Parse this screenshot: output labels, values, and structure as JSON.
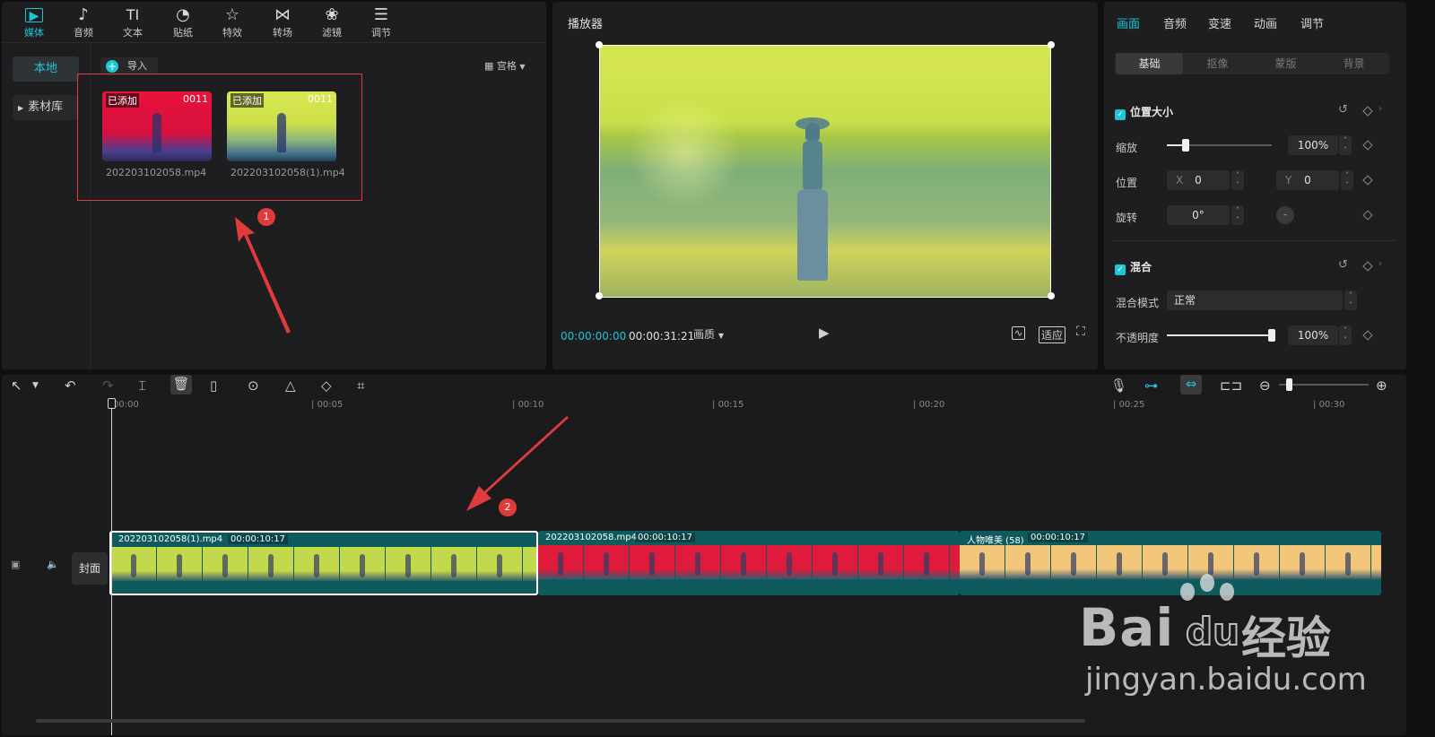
{
  "media_toolbar": {
    "items": [
      {
        "label": "媒体",
        "icon": "play-square-icon",
        "glyph": "▶"
      },
      {
        "label": "音频",
        "icon": "music-note-icon",
        "glyph": "♪"
      },
      {
        "label": "文本",
        "icon": "text-icon",
        "glyph": "TI"
      },
      {
        "label": "贴纸",
        "icon": "sticker-icon",
        "glyph": "◔"
      },
      {
        "label": "特效",
        "icon": "sparkle-icon",
        "glyph": "☆"
      },
      {
        "label": "转场",
        "icon": "transition-icon",
        "glyph": "⋈"
      },
      {
        "label": "滤镜",
        "icon": "filter-icon",
        "glyph": "❀"
      },
      {
        "label": "调节",
        "icon": "sliders-icon",
        "glyph": "☰"
      }
    ]
  },
  "media_sidebar": {
    "local": "本地",
    "library": "素材库"
  },
  "media": {
    "import_label": "导入",
    "view_label": "宫格",
    "assets": [
      {
        "tag": "已添加",
        "duration": "0011",
        "name": "202203102058.mp4"
      },
      {
        "tag": "已添加",
        "duration": "0011",
        "name": "202203102058(1).mp4"
      }
    ]
  },
  "annotations": {
    "badge1": "1",
    "badge2": "2"
  },
  "player": {
    "title": "播放器",
    "current_time": "00:00:00:00",
    "total_time": "00:00:31:21",
    "quality_label": "画质",
    "fit_label": "适应"
  },
  "inspector": {
    "tabs": [
      "画面",
      "音频",
      "变速",
      "动画",
      "调节"
    ],
    "subtabs": [
      "基础",
      "抠像",
      "蒙版",
      "背景"
    ],
    "position_size": {
      "title": "位置大小",
      "scale_label": "缩放",
      "scale_value": "100%",
      "scale_fraction": 0.18,
      "position_label": "位置",
      "x_label": "X",
      "x_value": "0",
      "y_label": "Y",
      "y_value": "0",
      "rotate_label": "旋转",
      "rotate_value": "0°"
    },
    "blend": {
      "title": "混合",
      "mode_label": "混合模式",
      "mode_value": "正常",
      "opacity_label": "不透明度",
      "opacity_value": "100%",
      "opacity_fraction": 1.0
    }
  },
  "timeline": {
    "ruler": [
      "00:00",
      "00:05",
      "00:10",
      "00:15",
      "00:20",
      "00:25",
      "00:30"
    ],
    "cover_label": "封面",
    "clips": [
      {
        "name": "202203102058(1).mp4",
        "duration": "00:00:10:17",
        "selected": true,
        "tint": "#c4d84c"
      },
      {
        "name": "202203102058.mp4",
        "duration": "00:00:10:17",
        "selected": false,
        "tint": "#e01a3a"
      },
      {
        "name": "人物唯美 (58)",
        "duration": "00:00:10:17",
        "selected": false,
        "tint": "#f2c77a"
      }
    ]
  },
  "watermark": {
    "brand": "Bai",
    "brand_du": "du",
    "brand_cn": "经验",
    "url": "jingyan.baidu.com"
  },
  "colors": {
    "accent": "#1fc6d3",
    "annotation": "#e03b3b",
    "clip_track": "#0e5a5d"
  }
}
